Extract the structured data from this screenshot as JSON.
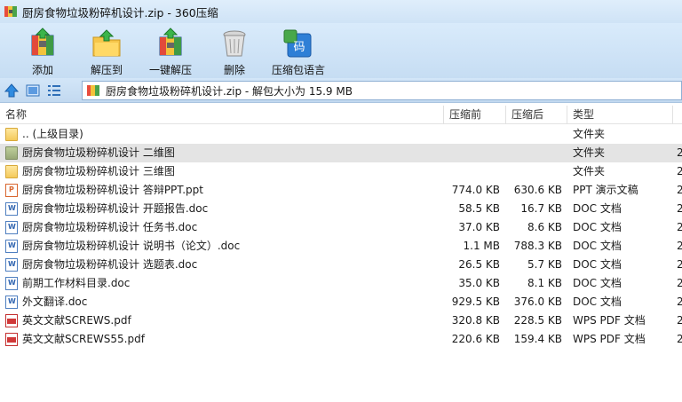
{
  "window": {
    "title": "厨房食物垃圾粉碎机设计.zip - 360压缩"
  },
  "toolbar": {
    "items": [
      {
        "label": "添加",
        "icon": "add-archive-icon"
      },
      {
        "label": "解压到",
        "icon": "extract-to-icon"
      },
      {
        "label": "一键解压",
        "icon": "one-click-extract-icon"
      },
      {
        "label": "删除",
        "icon": "trash-icon"
      },
      {
        "label": "压缩包语言",
        "icon": "archive-language-icon"
      }
    ]
  },
  "addressbar": {
    "path": "厨房食物垃圾粉碎机设计.zip - 解包大小为 15.9 MB"
  },
  "columns": {
    "name": "名称",
    "packed": "压缩前",
    "orig": "压缩后",
    "type": "类型"
  },
  "files": [
    {
      "name": ".. (上级目录)",
      "packed": "",
      "orig": "",
      "type": "文件夹",
      "extra": "",
      "icon": "folder"
    },
    {
      "name": "厨房食物垃圾粉碎机设计 二维图",
      "packed": "",
      "orig": "",
      "type": "文件夹",
      "extra": "2",
      "icon": "folder-dark"
    },
    {
      "name": "厨房食物垃圾粉碎机设计 三维图",
      "packed": "",
      "orig": "",
      "type": "文件夹",
      "extra": "2",
      "icon": "folder"
    },
    {
      "name": "厨房食物垃圾粉碎机设计 答辩PPT.ppt",
      "packed": "774.0 KB",
      "orig": "630.6 KB",
      "type": "PPT 演示文稿",
      "extra": "2",
      "icon": "ppt"
    },
    {
      "name": "厨房食物垃圾粉碎机设计 开题报告.doc",
      "packed": "58.5 KB",
      "orig": "16.7 KB",
      "type": "DOC 文档",
      "extra": "2",
      "icon": "doc"
    },
    {
      "name": "厨房食物垃圾粉碎机设计 任务书.doc",
      "packed": "37.0 KB",
      "orig": "8.6 KB",
      "type": "DOC 文档",
      "extra": "2",
      "icon": "doc"
    },
    {
      "name": "厨房食物垃圾粉碎机设计 说明书（论文）.doc",
      "packed": "1.1 MB",
      "orig": "788.3 KB",
      "type": "DOC 文档",
      "extra": "2",
      "icon": "doc"
    },
    {
      "name": "厨房食物垃圾粉碎机设计 选题表.doc",
      "packed": "26.5 KB",
      "orig": "5.7 KB",
      "type": "DOC 文档",
      "extra": "2",
      "icon": "doc"
    },
    {
      "name": "前期工作材料目录.doc",
      "packed": "35.0 KB",
      "orig": "8.1 KB",
      "type": "DOC 文档",
      "extra": "2",
      "icon": "doc"
    },
    {
      "name": "外文翻译.doc",
      "packed": "929.5 KB",
      "orig": "376.0 KB",
      "type": "DOC 文档",
      "extra": "2",
      "icon": "doc"
    },
    {
      "name": "英文文献SCREWS.pdf",
      "packed": "320.8 KB",
      "orig": "228.5 KB",
      "type": "WPS PDF 文档",
      "extra": "2",
      "icon": "pdf"
    },
    {
      "name": "英文文献SCREWS55.pdf",
      "packed": "220.6 KB",
      "orig": "159.4 KB",
      "type": "WPS PDF 文档",
      "extra": "2",
      "icon": "pdf"
    }
  ]
}
